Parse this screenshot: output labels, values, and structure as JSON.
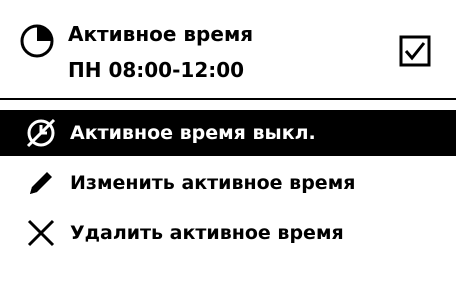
{
  "header": {
    "icon": "clock-icon",
    "title": "Активное время",
    "schedule": "ПН 08:00-12:00",
    "checkbox_checked": true
  },
  "menu": {
    "items": [
      {
        "icon": "disabled-clock-icon",
        "label": "Активное время выкл.",
        "selected": true
      },
      {
        "icon": "pencil-icon",
        "label": "Изменить активное время",
        "selected": false
      },
      {
        "icon": "cross-icon",
        "label": "Удалить активное время",
        "selected": false
      }
    ]
  },
  "colors": {
    "background": "#ffffff",
    "foreground": "#000000",
    "selected_background": "#000000",
    "selected_text": "#ffffff"
  }
}
